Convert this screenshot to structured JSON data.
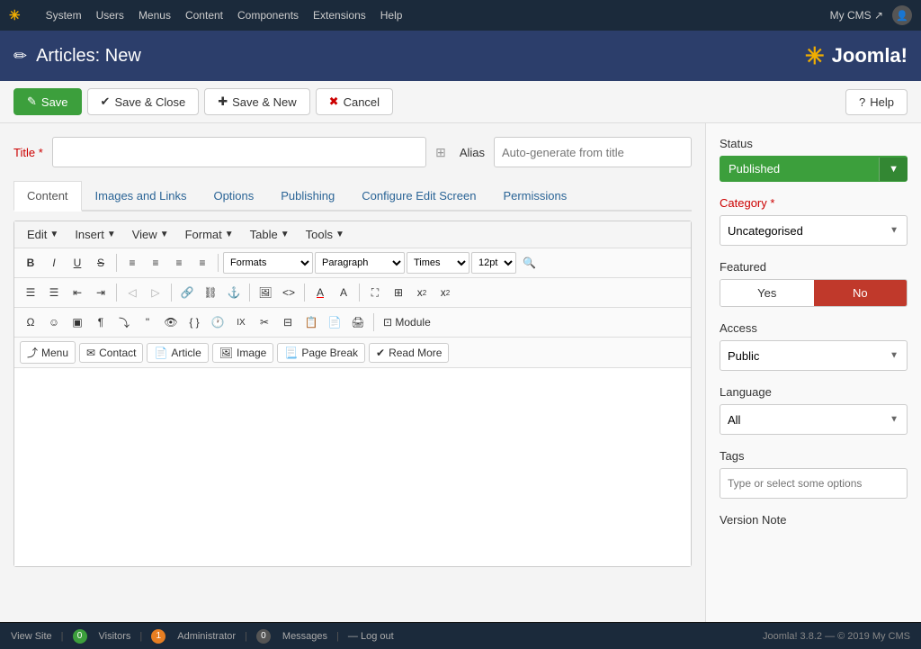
{
  "topnav": {
    "logo": "✳",
    "items": [
      "System",
      "Users",
      "Menus",
      "Content",
      "Components",
      "Extensions",
      "Help"
    ],
    "right": {
      "cms": "My CMS ↗",
      "user_icon": "👤"
    }
  },
  "header": {
    "icon": "✏",
    "title": "Articles: New",
    "joomla_text": "Joomla!"
  },
  "toolbar": {
    "save_label": "Save",
    "save_close_label": "Save & Close",
    "save_new_label": "Save & New",
    "cancel_label": "Cancel",
    "help_label": "Help"
  },
  "form": {
    "title_label": "Title",
    "title_required": "*",
    "title_placeholder": "",
    "alias_label": "Alias",
    "alias_placeholder": "Auto-generate from title"
  },
  "tabs": [
    {
      "id": "content",
      "label": "Content",
      "active": true
    },
    {
      "id": "images",
      "label": "Images and Links",
      "active": false
    },
    {
      "id": "options",
      "label": "Options",
      "active": false
    },
    {
      "id": "publishing",
      "label": "Publishing",
      "active": false
    },
    {
      "id": "configure",
      "label": "Configure Edit Screen",
      "active": false
    },
    {
      "id": "permissions",
      "label": "Permissions",
      "active": false
    }
  ],
  "editor": {
    "menus": [
      "Edit",
      "Insert",
      "View",
      "Format",
      "Table",
      "Tools"
    ],
    "toolbar1": {
      "formats_label": "Formats",
      "paragraph_label": "Paragraph",
      "font_label": "Times",
      "size_label": "12pt"
    }
  },
  "insert_buttons": [
    "Menu",
    "Contact",
    "Article",
    "Image",
    "Page Break",
    "Read More"
  ],
  "sidebar": {
    "status_label": "Status",
    "status_value": "Published",
    "category_label": "Category",
    "category_required": "*",
    "category_value": "Uncategorised",
    "featured_label": "Featured",
    "featured_yes": "Yes",
    "featured_no": "No",
    "access_label": "Access",
    "access_value": "Public",
    "language_label": "Language",
    "language_value": "All",
    "tags_label": "Tags",
    "tags_placeholder": "Type or select some options",
    "version_label": "Version Note"
  },
  "footer": {
    "view_site": "View Site",
    "visitors_count": "0",
    "visitors_label": "Visitors",
    "admin_count": "1",
    "admin_label": "Administrator",
    "messages_count": "0",
    "messages_label": "Messages",
    "logout": "Log out",
    "version": "Joomla! 3.8.2 — © 2019 My CMS"
  }
}
